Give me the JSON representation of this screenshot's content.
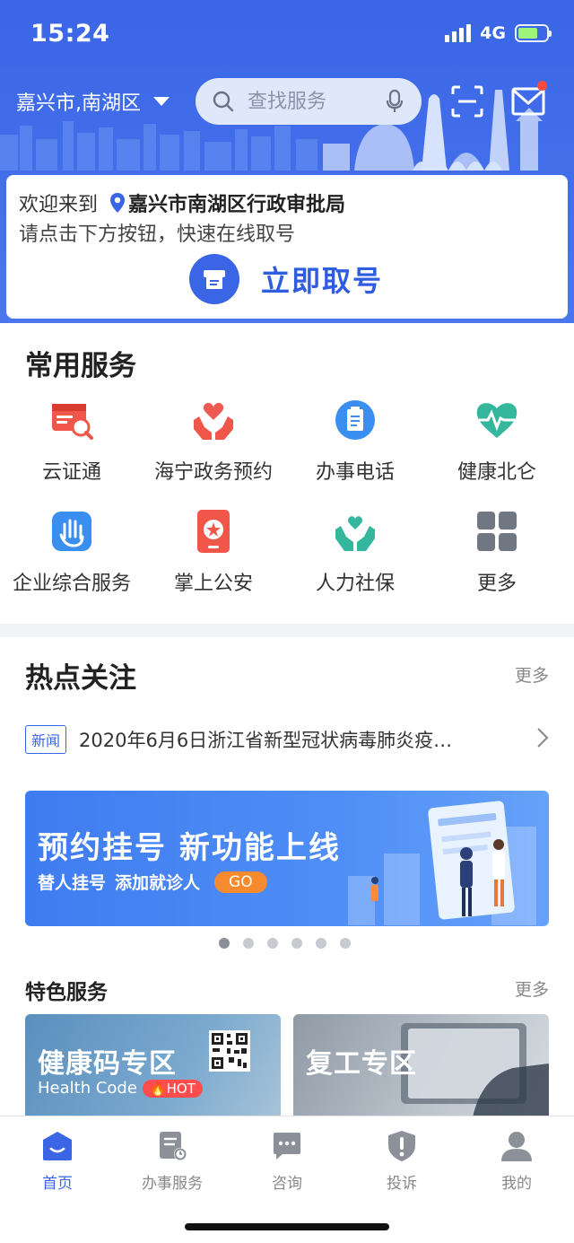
{
  "status_bar": {
    "time": "15:24",
    "network": "4G"
  },
  "header": {
    "location": "嘉兴市,南湖区",
    "search_placeholder": "查找服务"
  },
  "welcome": {
    "prefix": "欢迎来到",
    "location": "嘉兴市南湖区行政审批局",
    "hint": "请点击下方按钮，快速在线取号",
    "button_label": "立即取号"
  },
  "common_services": {
    "title": "常用服务",
    "items": [
      {
        "label": "云证通",
        "icon": "id-card-search-icon"
      },
      {
        "label": "海宁政务预约",
        "icon": "heart-hands-icon"
      },
      {
        "label": "办事电话",
        "icon": "clipboard-icon"
      },
      {
        "label": "健康北仑",
        "icon": "heart-pulse-icon"
      },
      {
        "label": "企业综合服务",
        "icon": "hand-icon"
      },
      {
        "label": "掌上公安",
        "icon": "police-badge-icon"
      },
      {
        "label": "人力社保",
        "icon": "people-hands-icon"
      },
      {
        "label": "更多",
        "icon": "grid-icon"
      }
    ]
  },
  "hot_topics": {
    "title": "热点关注",
    "more": "更多",
    "news_tag": "新闻",
    "news_text": "2020年6月6日浙江省新型冠状病毒肺炎疫…",
    "banner": {
      "title": "预约挂号  新功能上线",
      "sub1": "替人挂号",
      "sub2": "添加就诊人",
      "go": "GO",
      "slide_count": 6,
      "active_slide": 0
    }
  },
  "featured": {
    "title": "特色服务",
    "more": "更多",
    "items": [
      {
        "label": "健康码专区",
        "subtitle": "Health Code",
        "badge": "HOT"
      },
      {
        "label": "复工专区"
      }
    ]
  },
  "tabbar": {
    "items": [
      {
        "label": "首页",
        "icon": "home-icon",
        "active": true
      },
      {
        "label": "办事服务",
        "icon": "document-icon",
        "active": false
      },
      {
        "label": "咨询",
        "icon": "chat-icon",
        "active": false
      },
      {
        "label": "投诉",
        "icon": "shield-alert-icon",
        "active": false
      },
      {
        "label": "我的",
        "icon": "user-icon",
        "active": false
      }
    ]
  },
  "colors": {
    "primary": "#3a66e6",
    "accent": "#f58b2e",
    "alert": "#ff4d4d"
  }
}
